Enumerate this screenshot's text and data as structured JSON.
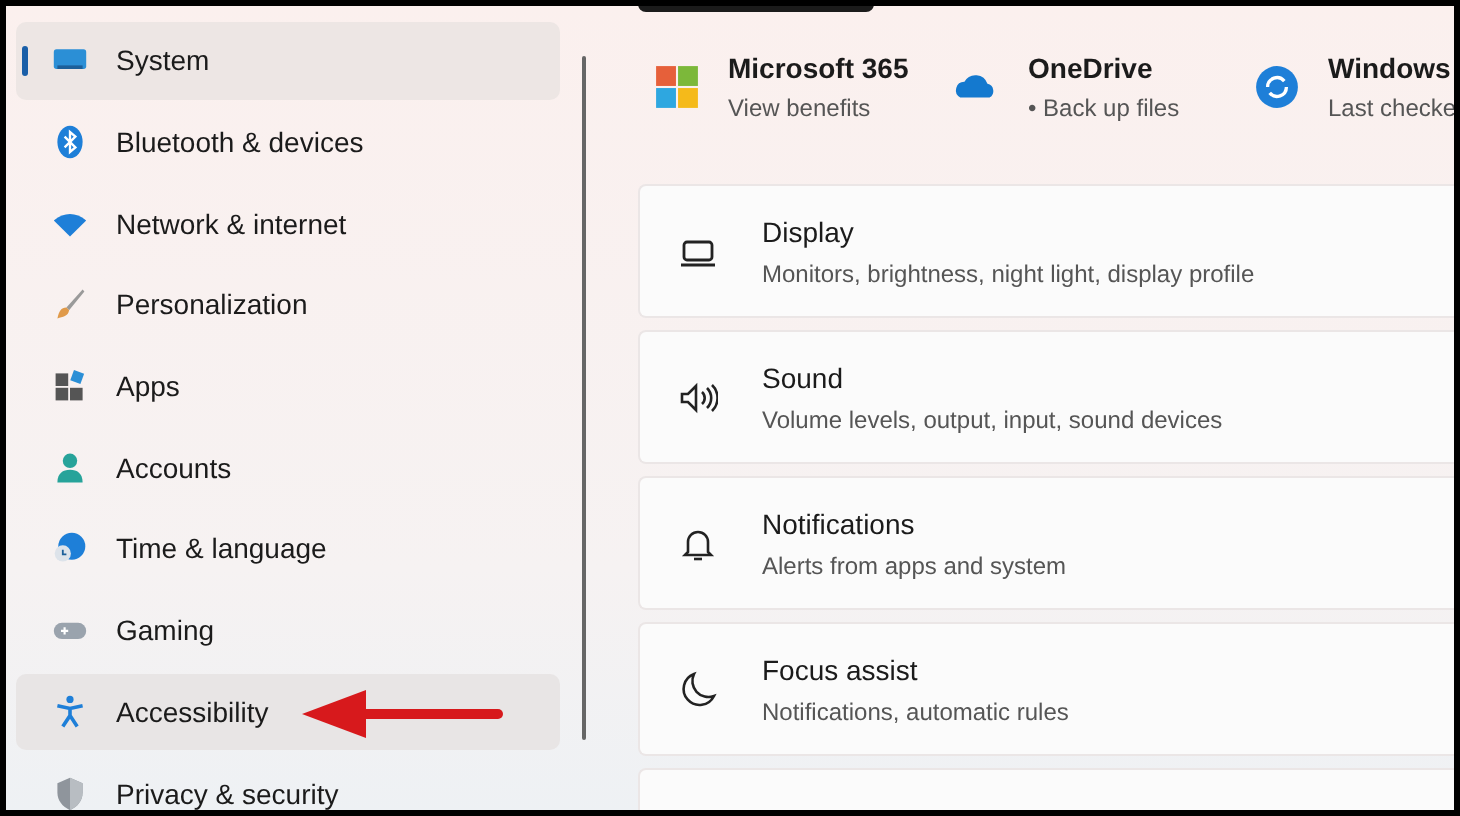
{
  "sidebar": {
    "items": [
      {
        "label": "System",
        "selected": true,
        "hovered": false,
        "arrow": false
      },
      {
        "label": "Bluetooth & devices",
        "selected": false,
        "hovered": false,
        "arrow": false
      },
      {
        "label": "Network & internet",
        "selected": false,
        "hovered": false,
        "arrow": false
      },
      {
        "label": "Personalization",
        "selected": false,
        "hovered": false,
        "arrow": false
      },
      {
        "label": "Apps",
        "selected": false,
        "hovered": false,
        "arrow": false
      },
      {
        "label": "Accounts",
        "selected": false,
        "hovered": false,
        "arrow": false
      },
      {
        "label": "Time & language",
        "selected": false,
        "hovered": false,
        "arrow": false
      },
      {
        "label": "Gaming",
        "selected": false,
        "hovered": false,
        "arrow": false
      },
      {
        "label": "Accessibility",
        "selected": false,
        "hovered": true,
        "arrow": true
      },
      {
        "label": "Privacy & security",
        "selected": false,
        "hovered": false,
        "arrow": false
      }
    ]
  },
  "quick_links": [
    {
      "title": "Microsoft 365",
      "subtitle": "View benefits"
    },
    {
      "title": "OneDrive",
      "subtitle": "• Back up files"
    },
    {
      "title": "Windows",
      "subtitle": "Last checke"
    }
  ],
  "settings": [
    {
      "title": "Display",
      "subtitle": "Monitors, brightness, night light, display profile"
    },
    {
      "title": "Sound",
      "subtitle": "Volume levels, output, input, sound devices"
    },
    {
      "title": "Notifications",
      "subtitle": "Alerts from apps and system"
    },
    {
      "title": "Focus assist",
      "subtitle": "Notifications, automatic rules"
    }
  ]
}
